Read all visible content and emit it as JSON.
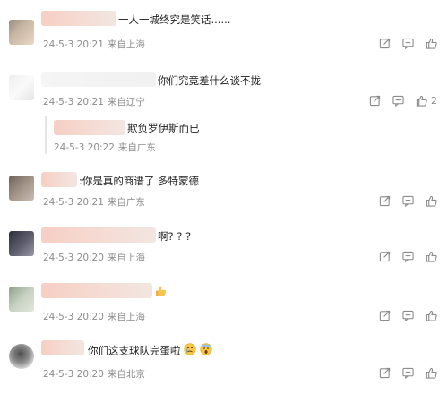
{
  "comments": [
    {
      "text": "一人一城终究是笑话......",
      "time": "24-5-3 20:21",
      "location": "来自上海"
    },
    {
      "text": "你们究竟差什么谈不拢",
      "time": "24-5-3 20:21",
      "location": "来自辽宁",
      "likes": "2"
    },
    {
      "text": "欺负罗伊斯而已",
      "time": "24-5-3 20:22",
      "location": "来自广东"
    },
    {
      "text": ":你是真的商谱了 多特蒙德",
      "time": "24-5-3 20:21",
      "location": "来自广东"
    },
    {
      "text": "啊? ? ?",
      "time": "24-5-3 20:20",
      "location": "来自上海"
    },
    {
      "text": "",
      "time": "24-5-3 20:20",
      "location": "来自上海"
    },
    {
      "text": "你们这支球队完蛋啦",
      "time": "24-5-3 20:20",
      "location": "来自北京"
    }
  ],
  "icons": {
    "share": "share-icon",
    "comment": "comment-icon",
    "like": "thumbs-up-icon",
    "thumb_emoji": "thumbs-up-emoji",
    "cry_emoji": "crying-face-emoji",
    "scream_emoji": "screaming-face-emoji"
  }
}
